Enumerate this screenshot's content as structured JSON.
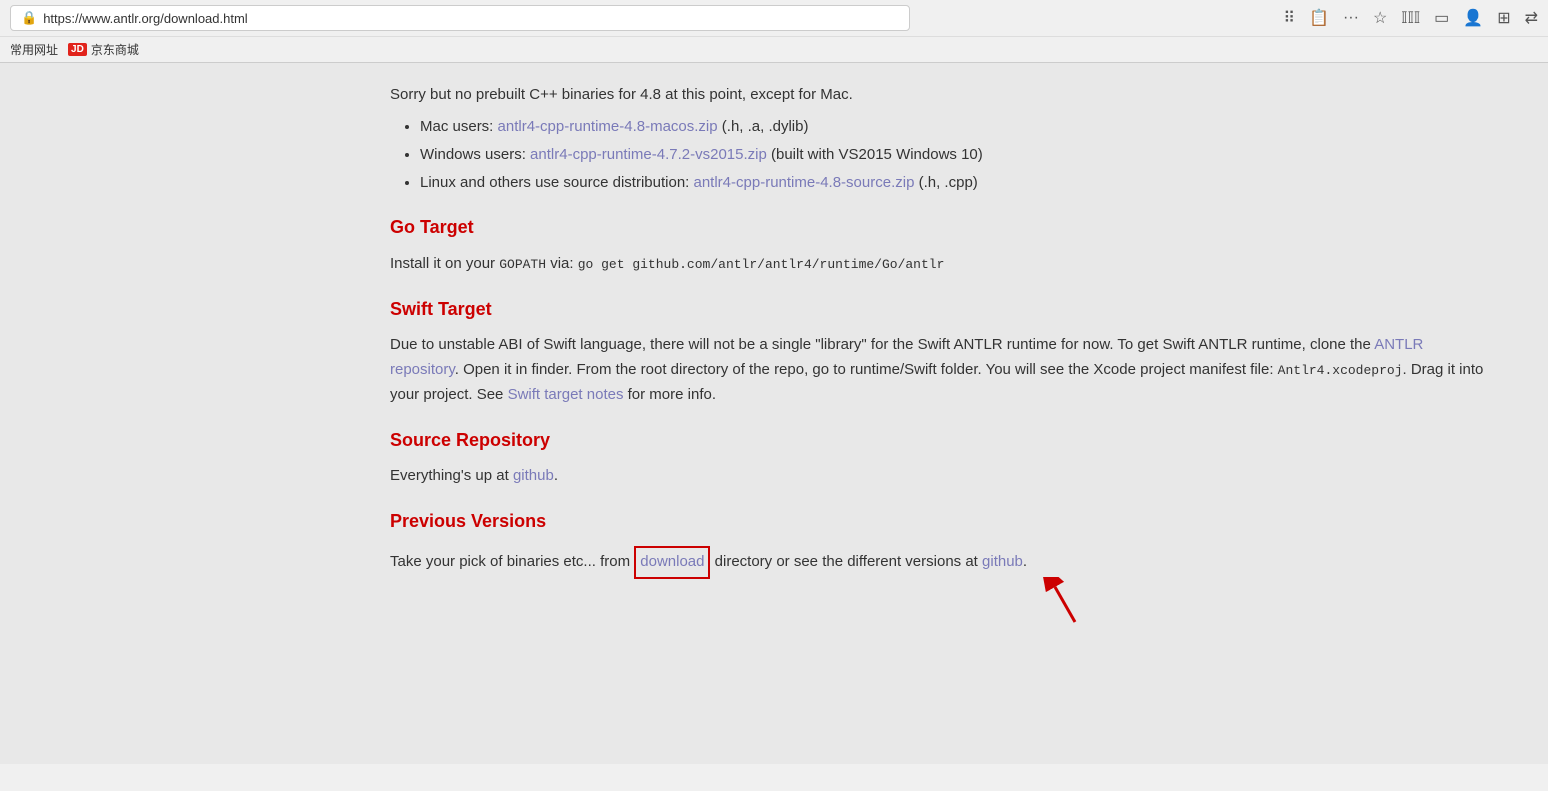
{
  "browser": {
    "url": "https://www.antlr.org/download.html",
    "bookmarks": [
      {
        "label": "常用网址"
      },
      {
        "label": "京东商城",
        "has_icon": true
      }
    ],
    "toolbar_icons": [
      "qr-code",
      "reader-mode",
      "more-options",
      "bookmark-star",
      "library",
      "reader-view",
      "account",
      "multi-view",
      "extension"
    ]
  },
  "page": {
    "cpp_section": {
      "intro": "Sorry but no prebuilt C++ binaries for 4.8 at this point, except for Mac.",
      "bullets": [
        {
          "label": "Mac users: ",
          "link_text": "antlr4-cpp-runtime-4.8-macos.zip",
          "link_suffix": " (.h, .a, .dylib)"
        },
        {
          "label": "Windows users: ",
          "link_text": "antlr4-cpp-runtime-4.7.2-vs2015.zip",
          "link_suffix": " (built with VS2015 Windows 10)"
        },
        {
          "label": "Linux and others use source distribution: ",
          "link_text": "antlr4-cpp-runtime-4.8-source.zip",
          "link_suffix": " (.h, .cpp)"
        }
      ]
    },
    "go_target": {
      "heading": "Go Target",
      "text_before": "Install it on your ",
      "gopath_code": "GOPATH",
      "text_middle": " via: ",
      "command_code": "go get github.com/antlr/antlr4/runtime/Go/antlr"
    },
    "swift_target": {
      "heading": "Swift Target",
      "paragraph1": "Due to unstable ABI of Swift language, there will not be a single \"library\" for the Swift ANTLR runtime for now. To get Swift ANTLR runtime, clone the ",
      "antlr_link": "ANTLR repository",
      "paragraph1_after": ". Open it in finder. From the root directory of the repo, go to runtime/Swift folder. You will see the Xcode project manifest file: ",
      "xcode_code": "Antlr4.xcodeproj",
      "paragraph2": ". Drag it into your project. See ",
      "swift_notes_link": "Swift target notes",
      "paragraph2_after": " for more info."
    },
    "source_repository": {
      "heading": "Source Repository",
      "text": "Everything's up at ",
      "github_link": "github",
      "text_after": "."
    },
    "previous_versions": {
      "heading": "Previous Versions",
      "text_before": "Take your pick of binaries etc... from ",
      "download_link": "download",
      "text_middle": " directory or see the different versions at ",
      "github_link": "github",
      "text_after": "."
    }
  }
}
